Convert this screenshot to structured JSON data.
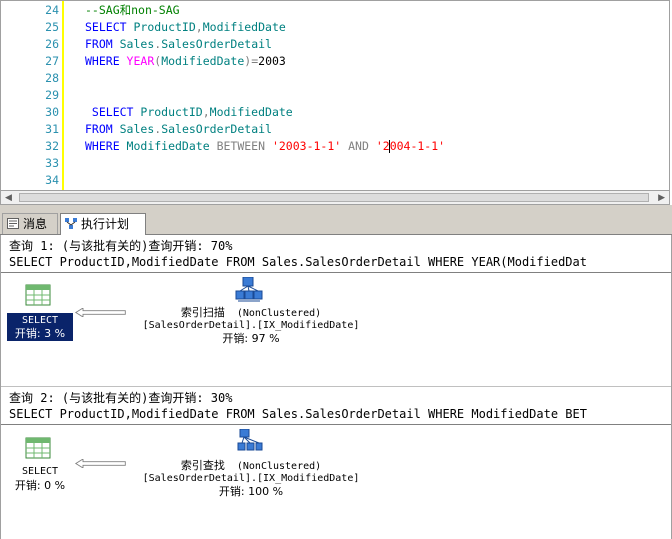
{
  "editor": {
    "lines": [
      {
        "num": "24",
        "tokens": [
          {
            "t": "--SAG和non-SAG",
            "c": "cm"
          }
        ]
      },
      {
        "num": "25",
        "tokens": [
          {
            "t": "SELECT ",
            "c": "kw"
          },
          {
            "t": "ProductID",
            "c": "obj"
          },
          {
            "t": ",",
            "c": "gray"
          },
          {
            "t": "ModifiedDate",
            "c": "obj"
          }
        ]
      },
      {
        "num": "26",
        "tokens": [
          {
            "t": "FROM ",
            "c": "kw"
          },
          {
            "t": "Sales",
            "c": "obj"
          },
          {
            "t": ".",
            "c": "gray"
          },
          {
            "t": "SalesOrderDetail",
            "c": "obj"
          }
        ]
      },
      {
        "num": "27",
        "tokens": [
          {
            "t": "WHERE ",
            "c": "kw"
          },
          {
            "t": "YEAR",
            "c": "fn"
          },
          {
            "t": "(",
            "c": "gray"
          },
          {
            "t": "ModifiedDate",
            "c": "obj"
          },
          {
            "t": ")",
            "c": "gray"
          },
          {
            "t": "=",
            "c": "gray"
          },
          {
            "t": "2003",
            "c": "plain"
          }
        ]
      },
      {
        "num": "28",
        "tokens": []
      },
      {
        "num": "29",
        "tokens": []
      },
      {
        "num": "30",
        "tokens": [
          {
            "t": " SELECT ",
            "c": "kw"
          },
          {
            "t": "ProductID",
            "c": "obj"
          },
          {
            "t": ",",
            "c": "gray"
          },
          {
            "t": "ModifiedDate",
            "c": "obj"
          }
        ]
      },
      {
        "num": "31",
        "tokens": [
          {
            "t": "FROM ",
            "c": "kw"
          },
          {
            "t": "Sales",
            "c": "obj"
          },
          {
            "t": ".",
            "c": "gray"
          },
          {
            "t": "SalesOrderDetail",
            "c": "obj"
          }
        ]
      },
      {
        "num": "32",
        "tokens": [
          {
            "t": "WHERE ",
            "c": "kw"
          },
          {
            "t": "ModifiedDate ",
            "c": "obj"
          },
          {
            "t": "BETWEEN ",
            "c": "gray"
          },
          {
            "t": "'2003-1-1'",
            "c": "str"
          },
          {
            "t": " AND ",
            "c": "gray"
          },
          {
            "t": "'2",
            "c": "str"
          },
          {
            "t": "|caret|",
            "c": "caret"
          },
          {
            "t": "004-1-1'",
            "c": "str"
          }
        ]
      },
      {
        "num": "33",
        "tokens": []
      },
      {
        "num": "34",
        "tokens": []
      }
    ]
  },
  "tabs": {
    "messages": "消息",
    "plan": "执行计划"
  },
  "queries": [
    {
      "header": "查询 1: (与该批有关的)查询开销: 70%",
      "sql": "SELECT ProductID,ModifiedDate FROM Sales.SalesOrderDetail WHERE YEAR(ModifiedDat",
      "select_label": "SELECT",
      "select_cost": "开销: 3 %",
      "op_name": "索引扫描",
      "op_kind": "(NonClustered)",
      "op_object": "[SalesOrderDetail].[IX_ModifiedDate]",
      "op_cost": "开销: 97 %"
    },
    {
      "header": "查询 2: (与该批有关的)查询开销: 30%",
      "sql": "SELECT ProductID,ModifiedDate FROM Sales.SalesOrderDetail WHERE ModifiedDate BET",
      "select_label": "SELECT",
      "select_cost": "开销: 0 %",
      "op_name": "索引查找",
      "op_kind": "(NonClustered)",
      "op_object": "[SalesOrderDetail].[IX_ModifiedDate]",
      "op_cost": "开销: 100 %"
    }
  ],
  "colors": {
    "keyword": "#0000ff",
    "function": "#ff00ff",
    "string": "#ff0000",
    "comment": "#008000",
    "selection": "#0a246a"
  }
}
